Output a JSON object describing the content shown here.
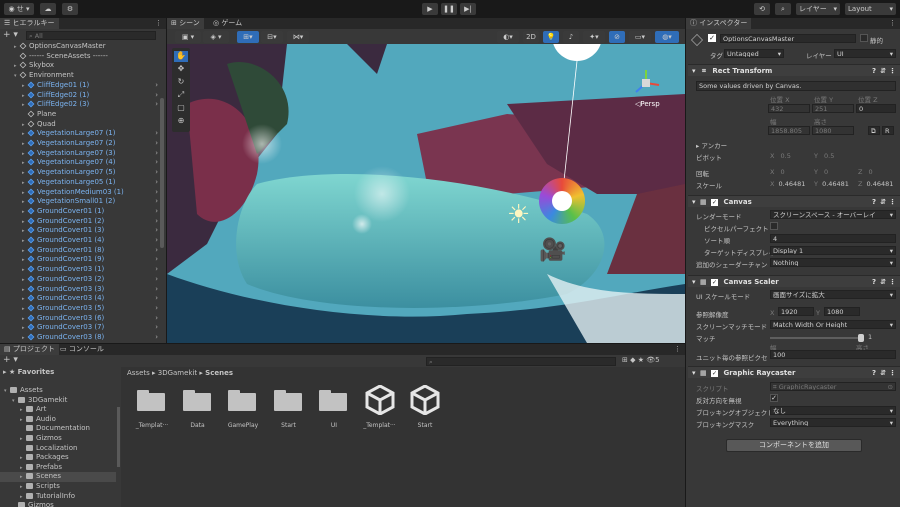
{
  "toolbar": {
    "account": "せ",
    "play_icon": "play-icon",
    "layers": "レイヤー",
    "layout": "Layout"
  },
  "hierarchy": {
    "tab": "ヒエラルキー",
    "search_placeholder": "All",
    "rows": [
      {
        "label": "OptionsCanvasMaster",
        "indent": 2,
        "blue": false,
        "arrow": "▸"
      },
      {
        "label": "------ SceneAssets ------",
        "indent": 2,
        "blue": false,
        "arrow": ""
      },
      {
        "label": "Skybox",
        "indent": 2,
        "blue": false,
        "arrow": "▸"
      },
      {
        "label": "Environment",
        "indent": 2,
        "blue": false,
        "arrow": "▾"
      },
      {
        "label": "CliffEdge01 (1)",
        "indent": 3,
        "blue": true,
        "arrow": "▸"
      },
      {
        "label": "CliffEdge02 (1)",
        "indent": 3,
        "blue": true,
        "arrow": "▸"
      },
      {
        "label": "CliffEdge02 (3)",
        "indent": 3,
        "blue": true,
        "arrow": "▸"
      },
      {
        "label": "Plane",
        "indent": 3,
        "blue": false,
        "arrow": ""
      },
      {
        "label": "Quad",
        "indent": 3,
        "blue": false,
        "arrow": "▸"
      },
      {
        "label": "VegetationLarge07 (1)",
        "indent": 3,
        "blue": true,
        "arrow": "▸"
      },
      {
        "label": "VegetationLarge07 (2)",
        "indent": 3,
        "blue": true,
        "arrow": "▸"
      },
      {
        "label": "VegetationLarge07 (3)",
        "indent": 3,
        "blue": true,
        "arrow": "▸"
      },
      {
        "label": "VegetationLarge07 (4)",
        "indent": 3,
        "blue": true,
        "arrow": "▸"
      },
      {
        "label": "VegetationLarge07 (5)",
        "indent": 3,
        "blue": true,
        "arrow": "▸"
      },
      {
        "label": "VegetationLarge05 (1)",
        "indent": 3,
        "blue": true,
        "arrow": "▸"
      },
      {
        "label": "VegetationMedium03 (1)",
        "indent": 3,
        "blue": true,
        "arrow": "▸"
      },
      {
        "label": "VegetationSmall01 (2)",
        "indent": 3,
        "blue": true,
        "arrow": "▸"
      },
      {
        "label": "GroundCover01 (1)",
        "indent": 3,
        "blue": true,
        "arrow": "▸"
      },
      {
        "label": "GroundCover01 (2)",
        "indent": 3,
        "blue": true,
        "arrow": "▸"
      },
      {
        "label": "GroundCover01 (3)",
        "indent": 3,
        "blue": true,
        "arrow": "▸"
      },
      {
        "label": "GroundCover01 (4)",
        "indent": 3,
        "blue": true,
        "arrow": "▸"
      },
      {
        "label": "GroundCover01 (8)",
        "indent": 3,
        "blue": true,
        "arrow": "▸"
      },
      {
        "label": "GroundCover01 (9)",
        "indent": 3,
        "blue": true,
        "arrow": "▸"
      },
      {
        "label": "GroundCover03 (1)",
        "indent": 3,
        "blue": true,
        "arrow": "▸"
      },
      {
        "label": "GroundCover03 (2)",
        "indent": 3,
        "blue": true,
        "arrow": "▸"
      },
      {
        "label": "GroundCover03 (3)",
        "indent": 3,
        "blue": true,
        "arrow": "▸"
      },
      {
        "label": "GroundCover03 (4)",
        "indent": 3,
        "blue": true,
        "arrow": "▸"
      },
      {
        "label": "GroundCover03 (5)",
        "indent": 3,
        "blue": true,
        "arrow": "▸"
      },
      {
        "label": "GroundCover03 (6)",
        "indent": 3,
        "blue": true,
        "arrow": "▸"
      },
      {
        "label": "GroundCover03 (7)",
        "indent": 3,
        "blue": true,
        "arrow": "▸"
      },
      {
        "label": "GroundCover03 (8)",
        "indent": 3,
        "blue": true,
        "arrow": "▸"
      }
    ]
  },
  "scene": {
    "tab_scene": "シーン",
    "tab_game": "ゲーム",
    "btn_2d": "2D",
    "persp": "Persp",
    "tool_icons": [
      "hand-icon",
      "move-icon",
      "rotate-icon",
      "scale-icon",
      "rect-icon",
      "transform-icon"
    ]
  },
  "project": {
    "tab_project": "プロジェクト",
    "tab_console": "コンソール",
    "favorites": "Favorites",
    "tree": [
      {
        "label": "Assets",
        "indent": 0,
        "arrow": "▾"
      },
      {
        "label": "3DGamekit",
        "indent": 1,
        "arrow": "▾"
      },
      {
        "label": "Art",
        "indent": 2,
        "arrow": "▸"
      },
      {
        "label": "Audio",
        "indent": 2,
        "arrow": "▸"
      },
      {
        "label": "Documentation",
        "indent": 2,
        "arrow": ""
      },
      {
        "label": "Gizmos",
        "indent": 2,
        "arrow": "▸"
      },
      {
        "label": "Localization",
        "indent": 2,
        "arrow": ""
      },
      {
        "label": "Packages",
        "indent": 2,
        "arrow": "▸"
      },
      {
        "label": "Prefabs",
        "indent": 2,
        "arrow": "▸"
      },
      {
        "label": "Scenes",
        "indent": 2,
        "arrow": "▸"
      },
      {
        "label": "Scripts",
        "indent": 2,
        "arrow": "▸"
      },
      {
        "label": "TutorialInfo",
        "indent": 2,
        "arrow": "▸"
      },
      {
        "label": "Gizmos",
        "indent": 1,
        "arrow": ""
      }
    ],
    "breadcrumb": [
      "Assets",
      "3DGamekit",
      "Scenes"
    ],
    "hidden_count": "5",
    "assets": [
      {
        "label": "_Templat···",
        "kind": "folder"
      },
      {
        "label": "Data",
        "kind": "folder"
      },
      {
        "label": "GamePlay",
        "kind": "folder"
      },
      {
        "label": "Start",
        "kind": "folder"
      },
      {
        "label": "UI",
        "kind": "folder"
      },
      {
        "label": "_Templat···",
        "kind": "unity"
      },
      {
        "label": "Start",
        "kind": "unity"
      }
    ]
  },
  "inspector": {
    "tab": "インスペクター",
    "object_name": "OptionsCanvasMaster",
    "static_label": "静的",
    "tag_label": "タグ",
    "tag_value": "Untagged",
    "layer_label": "レイヤー",
    "layer_value": "UI",
    "rect_transform": {
      "title": "Rect Transform",
      "note": "Some values driven by Canvas.",
      "pos_x_label": "位置 X",
      "pos_y_label": "位置 Y",
      "pos_z_label": "位置 Z",
      "pos_x": "432",
      "pos_y": "251",
      "pos_z": "0",
      "width_label": "幅",
      "height_label": "高さ",
      "width": "1858.805",
      "height": "1080",
      "anchor_label": "アンカー",
      "pivot_label": "ピボット",
      "pivot_x": "0.5",
      "pivot_y": "0.5",
      "rotation_label": "回転",
      "rot_x": "0",
      "rot_y": "0",
      "rot_z": "0",
      "scale_label": "スケール",
      "scale_x": "0.46481",
      "scale_y": "0.46481",
      "scale_z": "0.46481",
      "raw_btn": "R"
    },
    "canvas": {
      "title": "Canvas",
      "render_mode_label": "レンダーモード",
      "render_mode": "スクリーンスペース - オーバーレイ",
      "pixel_perfect_label": "ピクセルパーフェクト",
      "sort_order_label": "ソート順",
      "sort_order": "4",
      "target_display_label": "ターゲットディスプレイ",
      "target_display": "Display 1",
      "shader_channels_label": "追加のシェーダーチャンネル",
      "shader_channels": "Nothing"
    },
    "canvas_scaler": {
      "title": "Canvas Scaler",
      "scale_mode_label": "UI スケールモード",
      "scale_mode": "画面サイズに拡大",
      "ref_res_label": "参照解像度",
      "ref_x": "1920",
      "ref_y": "1080",
      "match_mode_label": "スクリーンマッチモード",
      "match_mode": "Match Width Or Height",
      "match_label": "マッチ",
      "match_value": "1",
      "match_fraction": 1.0,
      "width_word": "幅",
      "height_word": "高さ",
      "ppu_label": "ユニット毎の参照ピクセル数",
      "ppu": "100"
    },
    "graphic_raycaster": {
      "title": "Graphic Raycaster",
      "script_label": "スクリプト",
      "script": "GraphicRaycaster",
      "ignore_reversed_label": "反対方向を無視",
      "blocking_objects_label": "ブロッキングオブジェクト",
      "blocking_objects": "なし",
      "blocking_mask_label": "ブロッキングマスク",
      "blocking_mask": "Everything"
    },
    "add_component": "コンポーネントを追加"
  },
  "colors": {
    "accent_blue": "#3d7fd6",
    "prefab_blue": "#7bb3f0",
    "panel": "#383838"
  }
}
